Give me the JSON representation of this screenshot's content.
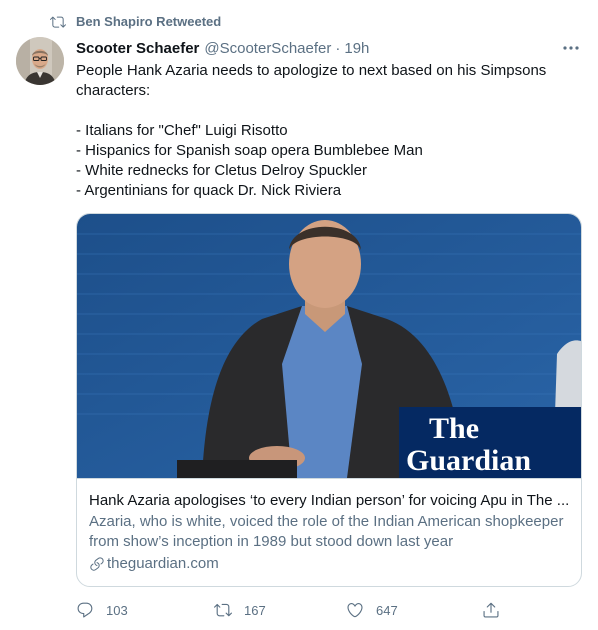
{
  "retweet": {
    "icon": "retweet-icon",
    "label": "Ben Shapiro Retweeted"
  },
  "author": {
    "avatar_icon": "avatar",
    "name": "Scooter Schaefer",
    "handle": "@ScooterSchaefer",
    "separator": "·",
    "time": "19h"
  },
  "more_icon": "more-options-icon",
  "tweet": {
    "lines": [
      "People Hank Azaria needs to apologize to next based on his Simpsons",
      "characters:",
      "",
      "- Italians for \"Chef\" Luigi Risotto",
      "- Hispanics for Spanish soap opera Bumblebee Man",
      "- White rednecks for Cletus Delroy Spuckler",
      "- Argentinians for quack Dr. Nick Riviera"
    ]
  },
  "card": {
    "image_logo_line1": "The",
    "image_logo_line2": "Guardian",
    "title": "Hank Azaria apologises ‘to every Indian person’ for voicing Apu in The ...",
    "description_line1": "Azaria, who is white, voiced the role of the Indian American shopkeeper",
    "description_line2": "from show’s inception in 1989 but stood down last year",
    "link_icon": "link-icon",
    "domain": "theguardian.com"
  },
  "actions": {
    "reply": {
      "icon": "reply-icon",
      "count": "103"
    },
    "retweet": {
      "icon": "retweet-icon",
      "count": "167"
    },
    "like": {
      "icon": "heart-icon",
      "count": "647"
    },
    "share": {
      "icon": "share-icon"
    }
  },
  "colors": {
    "secondary_text": "#5b7083",
    "primary_text": "#0f1419",
    "border": "#cfd9de",
    "guardian_blue": "#052962"
  }
}
